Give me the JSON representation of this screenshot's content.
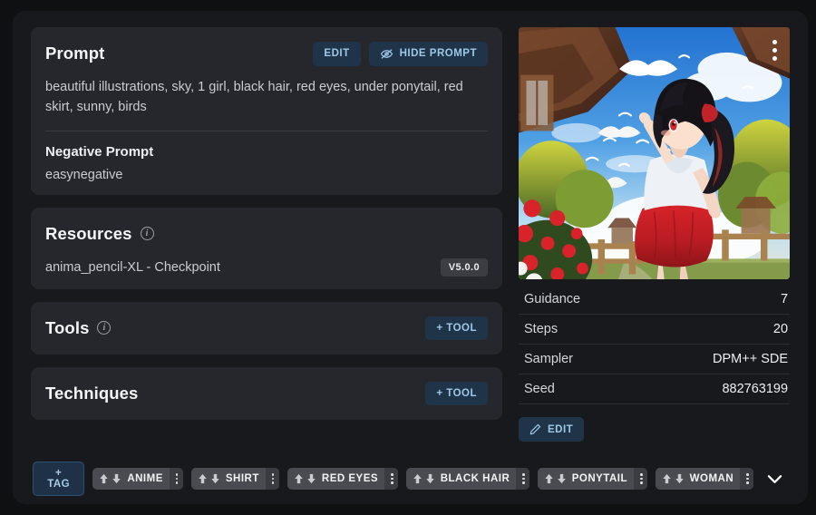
{
  "prompt_panel": {
    "title": "Prompt",
    "edit_label": "EDIT",
    "hide_label": "HIDE PROMPT",
    "prompt_text": "beautiful illustrations, sky, 1 girl, black hair, red eyes, under ponytail, red skirt, sunny, birds",
    "negative_title": "Negative Prompt",
    "negative_text": "easynegative"
  },
  "resources_panel": {
    "title": "Resources",
    "items": [
      {
        "name": "anima_pencil-XL - Checkpoint",
        "version": "V5.0.0"
      }
    ]
  },
  "tools_panel": {
    "title": "Tools",
    "add_label": "+ TOOL"
  },
  "techniques_panel": {
    "title": "Techniques",
    "add_label": "+ TOOL"
  },
  "image_panel": {
    "alt": "anime girl with black ponytail, red skirt, white shirt, looking up at birds in blue sky under japanese roof eaves",
    "menu_icon": "vertical-dots-icon"
  },
  "metadata": {
    "rows": [
      {
        "key": "Guidance",
        "value": "7"
      },
      {
        "key": "Steps",
        "value": "20"
      },
      {
        "key": "Sampler",
        "value": "DPM++ SDE"
      },
      {
        "key": "Seed",
        "value": "882763199"
      }
    ],
    "edit_label": "EDIT"
  },
  "tag_bar": {
    "add_label": "+ TAG",
    "tags": [
      "ANIME",
      "SHIRT",
      "RED EYES",
      "BLACK HAIR",
      "PONYTAIL",
      "WOMAN"
    ],
    "expand_icon": "chevron-down-icon"
  },
  "colors": {
    "page_bg": "#0f1012",
    "card_bg": "#18191c",
    "panel_bg": "#26272c",
    "accent_blue": "#9ec7e8",
    "btn_blue_bg": "#1f3448",
    "chip_bg": "#4a4b50",
    "badge_bg": "#3c3d42"
  }
}
